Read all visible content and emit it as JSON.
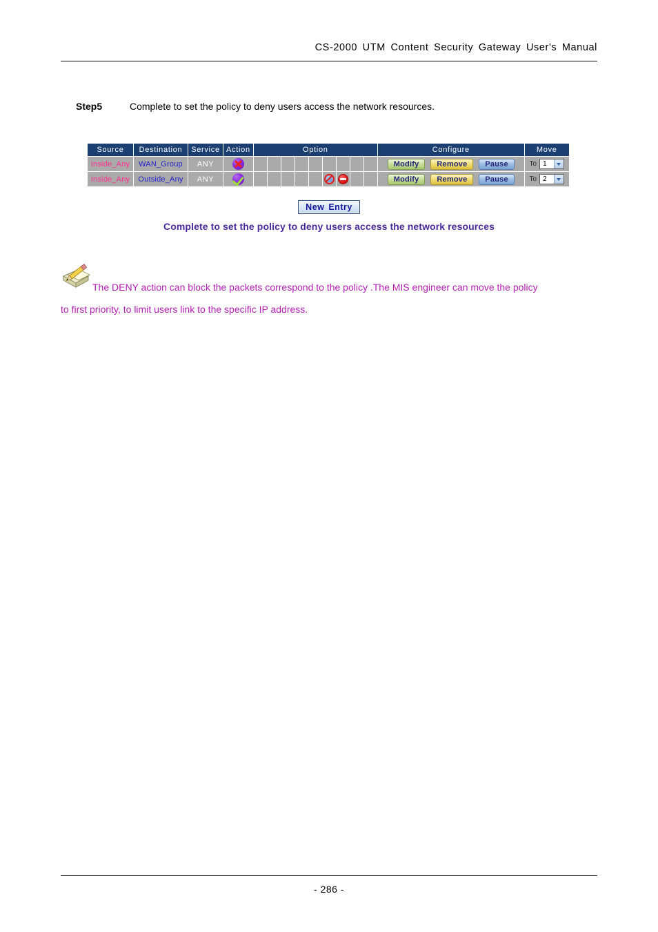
{
  "header": {
    "title": "CS-2000 UTM Content Security Gateway User's Manual"
  },
  "step": {
    "label": "Step5",
    "text": "Complete to set the policy to deny users access the network resources."
  },
  "policy_table": {
    "columns": {
      "source": "Source",
      "destination": "Destination",
      "service": "Service",
      "action": "Action",
      "option": "Option",
      "configure": "Configure",
      "move": "Move"
    },
    "option_cell_count": 9,
    "rows": [
      {
        "source": "Inside_Any",
        "destination": "WAN_Group",
        "service": "ANY",
        "action_icon": "deny-ball-icon",
        "option_icons": [
          null,
          null,
          null,
          null,
          null,
          null,
          null,
          null,
          null
        ],
        "configure": {
          "modify": "Modify",
          "remove": "Remove",
          "pause": "Pause"
        },
        "move": {
          "to_label": "To",
          "value": "1"
        }
      },
      {
        "source": "Inside_Any",
        "destination": "Outside_Any",
        "service": "ANY",
        "action_icon": "permit-ball-icon",
        "option_icons": [
          null,
          null,
          null,
          null,
          null,
          "no-signal-icon",
          "no-entry-icon",
          null,
          null
        ],
        "configure": {
          "modify": "Modify",
          "remove": "Remove",
          "pause": "Pause"
        },
        "move": {
          "to_label": "To",
          "value": "2"
        }
      }
    ]
  },
  "new_entry": {
    "label": "New Entry"
  },
  "caption": {
    "text": "Complete to set the policy to deny users access the network resources"
  },
  "note": {
    "icon": "pencil-notepad-icon",
    "line1": "The DENY action can block the packets correspond to the policy .The MIS engineer can move the policy",
    "line2": "to first priority, to limit users link to the specific IP address."
  },
  "footer": {
    "page_number": "- 286 -"
  },
  "colors": {
    "table_header_bg": "#1b3f70",
    "table_cell_bg": "#aaaaaa",
    "source_text": "#ff2d8f",
    "destination_text": "#2222cc",
    "caption_text": "#4b2a9e",
    "note_text": "#b51fb5",
    "new_entry_text": "#15169c"
  }
}
